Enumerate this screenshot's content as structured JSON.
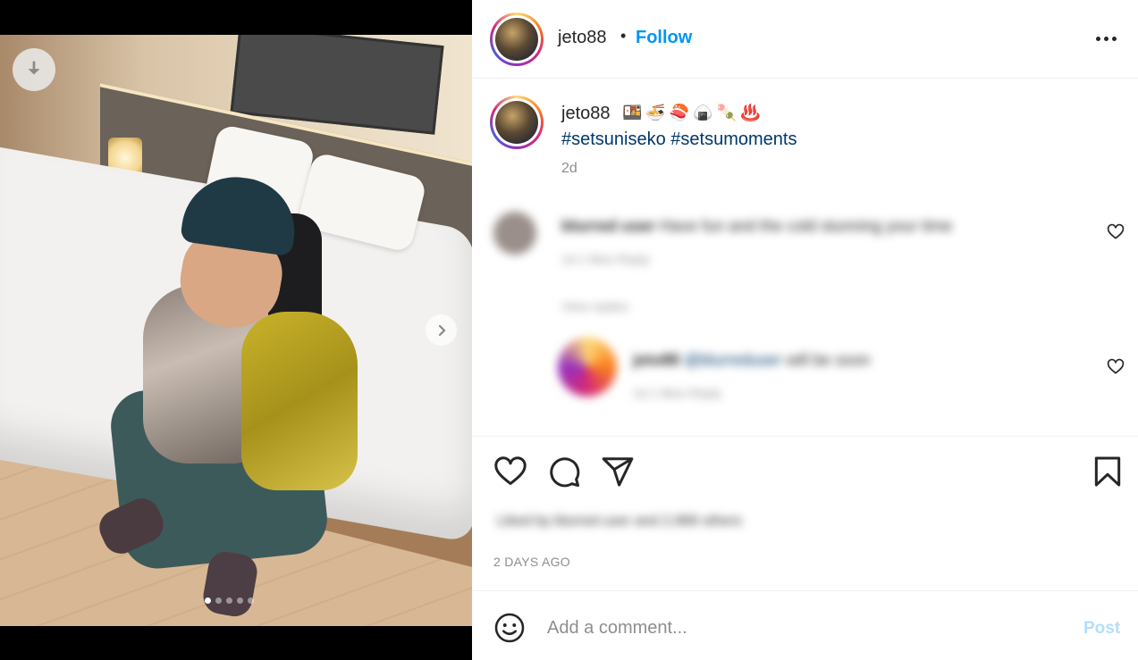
{
  "post": {
    "username": "jeto88",
    "separator": "•",
    "follow_label": "Follow",
    "more_icon": "more-options-icon"
  },
  "caption": {
    "username": "jeto88",
    "emojis": "🍱🍜🍣🍙🍡♨️",
    "hashtags": "#setsuniseko #setsumoments",
    "time": "2d"
  },
  "comments": [
    {
      "username": "blurred user",
      "text": "Have fun and the cold stunning your time",
      "meta": "1d  1 likes  Reply",
      "blurred": true
    },
    {
      "replies_label": "View replies",
      "username": "jeto88",
      "mention": "@blurreduser",
      "text": "will be soon",
      "meta": "1d  1 likes  Reply",
      "blurred": true
    }
  ],
  "actions": {
    "like_icon": "heart-icon",
    "comment_icon": "comment-icon",
    "share_icon": "send-icon",
    "save_icon": "bookmark-icon",
    "likes_text": "Liked by blurred user and 2,968 others",
    "date_label": "2 DAYS AGO"
  },
  "comment_box": {
    "placeholder": "Add a comment...",
    "post_label": "Post",
    "emoji_icon": "smiley-icon"
  },
  "media": {
    "slide_count": 5,
    "active_slide": 1,
    "download_icon": "download-icon",
    "next_icon": "chevron-right-icon"
  },
  "colors": {
    "link_blue": "#0095f6",
    "hashtag_blue": "#00376b",
    "muted": "#8e8e8e",
    "post_disabled": "#b2dffc"
  }
}
